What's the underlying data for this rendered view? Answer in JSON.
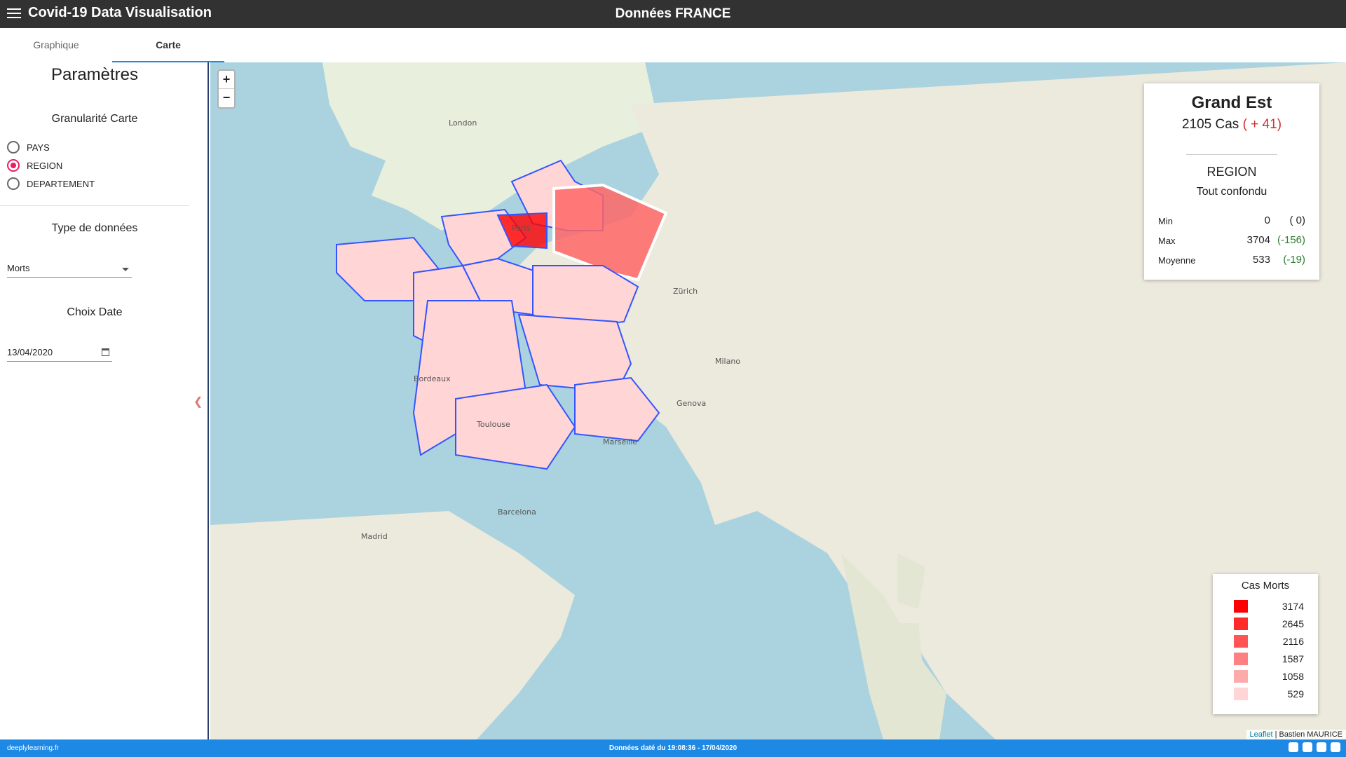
{
  "appbar": {
    "title": "Covid-19 Data Visualisation",
    "page_title": "Données FRANCE",
    "menu_icon": "hamburger-icon"
  },
  "tabs": [
    {
      "label": "Graphique",
      "active": false
    },
    {
      "label": "Carte",
      "active": true
    }
  ],
  "sidebar": {
    "title": "Paramètres",
    "granularity": {
      "label": "Granularité Carte",
      "options": [
        {
          "label": "PAYS",
          "checked": false
        },
        {
          "label": "REGION",
          "checked": true
        },
        {
          "label": "DEPARTEMENT",
          "checked": false
        }
      ]
    },
    "data_type": {
      "label": "Type de données",
      "selected": "Morts"
    },
    "date": {
      "label": "Choix Date",
      "value": "13/04/2020"
    }
  },
  "map": {
    "zoom_in": "+",
    "zoom_out": "−",
    "info": {
      "region": "Grand Est",
      "cases": "2105 Cas",
      "cases_delta": "( + 41)",
      "granularity": "REGION",
      "subtitle": "Tout confondu",
      "stats": [
        {
          "label": "Min",
          "value": "0",
          "delta": "( 0)",
          "delta_type": "zero"
        },
        {
          "label": "Max",
          "value": "3704",
          "delta": "(-156)",
          "delta_type": "neg"
        },
        {
          "label": "Moyenne",
          "value": "533",
          "delta": "(-19)",
          "delta_type": "neg"
        }
      ]
    },
    "legend": {
      "title": "Cas Morts",
      "items": [
        {
          "value": "3174",
          "color": "#ff0000"
        },
        {
          "value": "2645",
          "color": "#ff2a2a"
        },
        {
          "value": "2116",
          "color": "#ff5555"
        },
        {
          "value": "1587",
          "color": "#ff8080"
        },
        {
          "value": "1058",
          "color": "#ffaaaa"
        },
        {
          "value": "529",
          "color": "#ffd5d5"
        }
      ]
    },
    "city_labels": [
      "Paris",
      "Bordeaux",
      "Toulouse",
      "Marseille",
      "London",
      "Madrid",
      "Barcelona",
      "Genova",
      "Zürich",
      "Milano"
    ],
    "attribution": {
      "leaflet": "Leaflet",
      "author": "| Bastien MAURICE"
    }
  },
  "footer": {
    "left": "deeplylearning.fr",
    "center": "Données daté du 19:08:36 - 17/04/2020"
  },
  "colors": {
    "appbar": "#323232",
    "footer": "#1e88e5",
    "accent": "#e91e63",
    "border": "#3355ff"
  }
}
